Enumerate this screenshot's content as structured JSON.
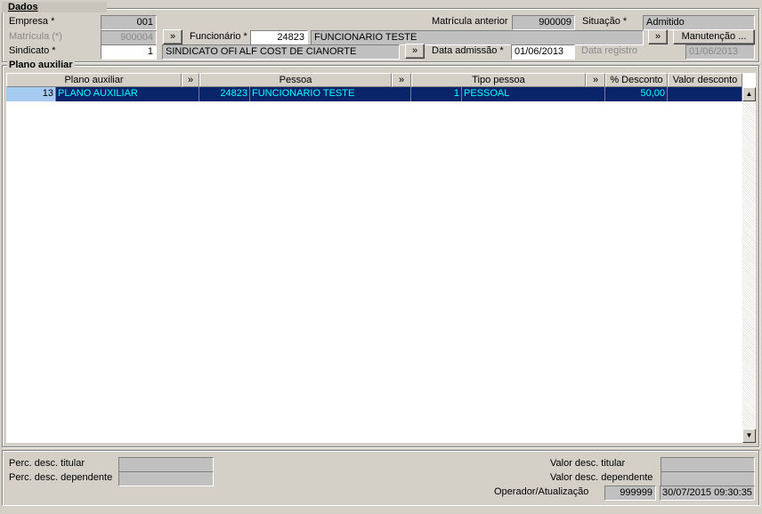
{
  "dados": {
    "title": "Dados",
    "empresa_label": "Empresa *",
    "empresa_value": "001",
    "matricula_label": "Matrícula (*)",
    "matricula_value": "900004",
    "sindicato_label": "Sindicato *",
    "sindicato_value": "1",
    "sindicato_name": "SINDICATO OFI ALF COST DE CIANORTE",
    "funcionario_label": "Funcionário *",
    "funcionario_value": "24823",
    "funcionario_name": "FUNCIONARIO TESTE",
    "matricula_anterior_label": "Matrícula anterior",
    "matricula_anterior_value": "900009",
    "situacao_label": "Situação *",
    "situacao_value": "Admitido",
    "data_admissao_label": "Data admissão *",
    "data_admissao_value": "01/06/2013",
    "data_registro_label": "Data registro",
    "data_registro_value": "01/06/2013",
    "manutencao_label": "Manutenção ...",
    "lookup_label": "»"
  },
  "plano": {
    "title": "Plano auxiliar",
    "columns": {
      "plano_auxiliar": "Plano auxiliar",
      "pessoa": "Pessoa",
      "tipo_pessoa": "Tipo pessoa",
      "perc_desconto": "% Desconto",
      "valor_desconto": "Valor desconto"
    },
    "lookup_label": "»",
    "rows": [
      {
        "plano_code": "13",
        "plano_name": "PLANO AUXILIAR",
        "pessoa_code": "24823",
        "pessoa_name": "FUNCIONARIO TESTE",
        "tipo_code": "1",
        "tipo_name": "PESSOAL",
        "perc_desconto": "50,00",
        "valor_desconto": ""
      }
    ]
  },
  "footer": {
    "perc_titular_label": "Perc. desc. titular",
    "perc_titular_value": "",
    "perc_dependente_label": "Perc. desc. dependente",
    "perc_dependente_value": "",
    "valor_titular_label": "Valor desc. titular",
    "valor_titular_value": "",
    "valor_dependente_label": "Valor desc. dependente",
    "valor_dependente_value": "",
    "operador_label": "Operador/Atualização",
    "operador_value": "999999",
    "atualizacao_value": "30/07/2015 09:30:35"
  },
  "colors": {
    "background": "#d4d0c8",
    "selection": "#0a246a",
    "selection_text": "#00ffff",
    "field_disabled": "#c0c0c0"
  },
  "icons": {
    "lookup": "double-chevron-right-icon",
    "scroll_up": "arrow-up-icon",
    "scroll_down": "arrow-down-icon"
  }
}
